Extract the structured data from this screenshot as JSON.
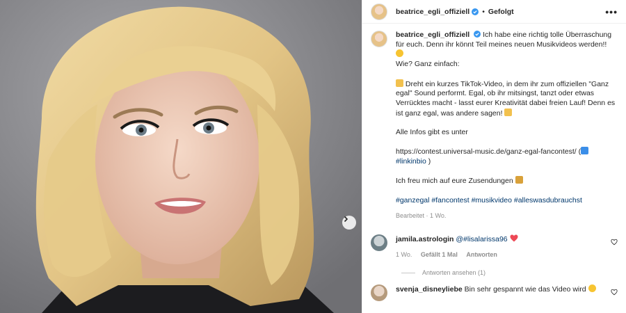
{
  "post": {
    "username": "beatrice_egli_offiziell",
    "follow_status": "Gefolgt",
    "more_label": "•••",
    "separator": "•"
  },
  "caption": {
    "line1": "Ich habe eine richtig tolle Überraschung",
    "line2": "für euch. Denn ihr könnt Teil meines neuen Musikvideos werden!!",
    "line3": "Wie? Ganz einfach:",
    "line4": "Dreht ein kurzes TikTok-Video, in dem ihr zum offiziellen \"Ganz",
    "line5": "egal\" Sound performt. Egal, ob ihr mitsingst, tanzt oder etwas",
    "line6": "Verrücktes macht - lasst eurer Kreativität dabei freien Lauf! Denn es",
    "line7": "ist ganz egal, was andere sagen!",
    "line8": "Alle Infos gibt es unter",
    "url": "https://contest.universal-music.de/ganz-egal-fancontest/",
    "open_paren": "(",
    "hashtag_bio": "#linkinbio",
    "close_paren": ")",
    "line9": "Ich freu mich auf eure Zusendungen",
    "hashtags": "#ganzegal #fancontest #musikvideo #alleswasdubrauchst",
    "edited": "Bearbeitet · 1 Wo."
  },
  "comments": [
    {
      "username": "jamila.astrologin",
      "text": "@#lisalarissa96",
      "time": "1 Wo.",
      "likes": "Gefällt 1 Mal",
      "reply": "Antworten",
      "view_replies": "Antworten ansehen (1)"
    },
    {
      "username": "svenja_disneyliebe",
      "text": "Bin sehr gespannt wie das Video wird"
    }
  ],
  "icons": {
    "verified": "verified-badge-icon",
    "more": "more-options-icon",
    "next": "chevron-right-icon",
    "heart": "heart-outline-icon"
  },
  "colors": {
    "link": "#00376b",
    "verified": "#3897f0",
    "muted": "#8e8e8e",
    "heart_red": "#ed4956"
  }
}
